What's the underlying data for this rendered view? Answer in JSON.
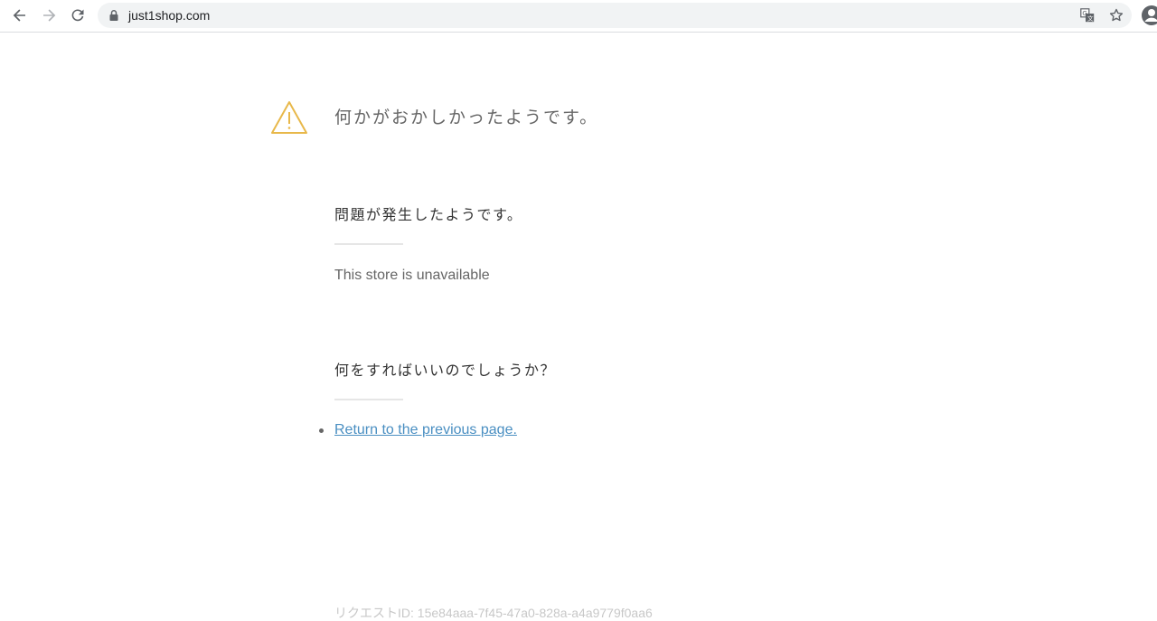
{
  "browser": {
    "url": "just1shop.com",
    "icons": {
      "back": "back-arrow-icon",
      "forward": "forward-arrow-icon",
      "reload": "reload-icon",
      "lock": "lock-icon",
      "translate": "translate-icon",
      "bookmark": "star-icon",
      "profile": "profile-icon"
    }
  },
  "page": {
    "heading": "何かがおかしかったようです。",
    "problem_title": "問題が発生したようです。",
    "problem_message": "This store is unavailable",
    "action_title": "何をすればいいのでしょうか？",
    "actions": [
      {
        "label": "Return to the previous page."
      }
    ],
    "request_id": "リクエストID: 15e84aaa-7f45-47a0-828a-a4a9779f0aa6"
  },
  "colors": {
    "warning": "#e8b84a",
    "link": "#4a8fc2",
    "heading_text": "#666666",
    "title_text": "#333333",
    "divider": "#e6e6e6"
  }
}
